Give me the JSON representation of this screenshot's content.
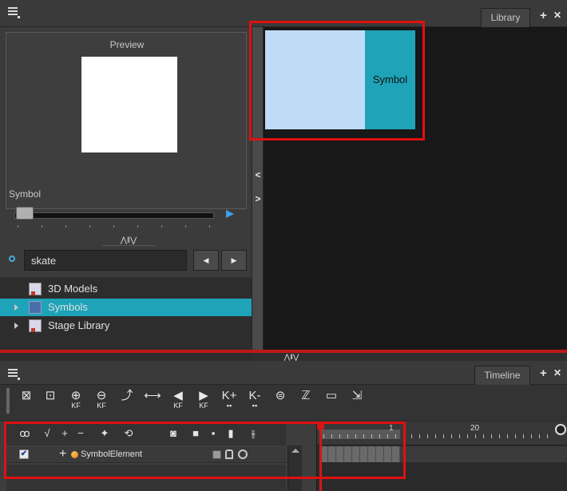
{
  "library": {
    "tab_label": "Library",
    "add_icon": "+",
    "close_icon": "✕",
    "preview_label": "Preview",
    "symbol_label": "Symbol",
    "collapse_glyph": "⋀‖⋁",
    "search": {
      "value": "skate",
      "placeholder": ""
    },
    "nav_prev": "◀",
    "nav_next": "▶",
    "tree": [
      {
        "label": "3D Models",
        "expandable": false,
        "selected": false
      },
      {
        "label": "Symbols",
        "expandable": true,
        "selected": true
      },
      {
        "label": "Stage Library",
        "expandable": true,
        "selected": false
      }
    ],
    "split_left": "<",
    "split_right": ">",
    "thumbnail_label": "Symbol"
  },
  "panel_collapse_glyph": "⋀‖⋁",
  "timeline": {
    "tab_label": "Timeline",
    "add_icon": "+",
    "close_icon": "✕",
    "toolbar": [
      {
        "icon": "add-drawing-icon",
        "glyph": "⊠",
        "label": ""
      },
      {
        "icon": "duplicate-drawing-icon",
        "glyph": "⊡",
        "label": ""
      },
      {
        "icon": "add-keyframe-icon",
        "glyph": "⊕",
        "label": "KF"
      },
      {
        "icon": "remove-keyframe-icon",
        "glyph": "⊖",
        "label": "KF"
      },
      {
        "icon": "motion-path-icon",
        "glyph": "⤴",
        "label": ""
      },
      {
        "icon": "constant-segment-icon",
        "glyph": "⟷",
        "label": ""
      },
      {
        "icon": "previous-keyframe-icon",
        "glyph": "◀",
        "label": "KF"
      },
      {
        "icon": "next-keyframe-icon",
        "glyph": "▶",
        "label": "KF"
      },
      {
        "icon": "set-keyframe-icon",
        "glyph": "K+",
        "label": "▪▪"
      },
      {
        "icon": "delete-keyframe-icon",
        "glyph": "K-",
        "label": "▪▪"
      },
      {
        "icon": "onion-skin-icon",
        "glyph": "⊜",
        "label": ""
      },
      {
        "icon": "tween-icon",
        "glyph": "ℤ",
        "label": ""
      },
      {
        "icon": "sequence-icon",
        "glyph": "▭",
        "label": ""
      },
      {
        "icon": "expand-icon",
        "glyph": "⇲",
        "label": ""
      }
    ],
    "layer_toolbar": [
      {
        "icon": "onion-skin-toggle-icon",
        "glyph": "ꝏ"
      },
      {
        "icon": "add-layer-dropdown-icon",
        "glyph": "√"
      },
      {
        "icon": "add-layer-icon",
        "glyph": "+"
      },
      {
        "icon": "remove-layer-icon",
        "glyph": "−"
      },
      {
        "icon": "add-peg-icon",
        "glyph": "✦"
      },
      {
        "icon": "add-parent-peg-icon",
        "glyph": "⟲"
      },
      {
        "icon": "show-hide-all-icon",
        "glyph": "◙"
      },
      {
        "icon": "lock-all-icon",
        "glyph": "■"
      },
      {
        "icon": "color-swatch-icon",
        "glyph": "▪"
      },
      {
        "icon": "layer-properties-icon",
        "glyph": "▮"
      },
      {
        "icon": "timeline-zoom-icon",
        "glyph": "⫳"
      }
    ],
    "layer": {
      "checked": true,
      "check_glyph": "✔",
      "add_glyph": "+",
      "name": "SymbolElement"
    },
    "ruler": {
      "labels": [
        "1",
        "20"
      ]
    }
  }
}
